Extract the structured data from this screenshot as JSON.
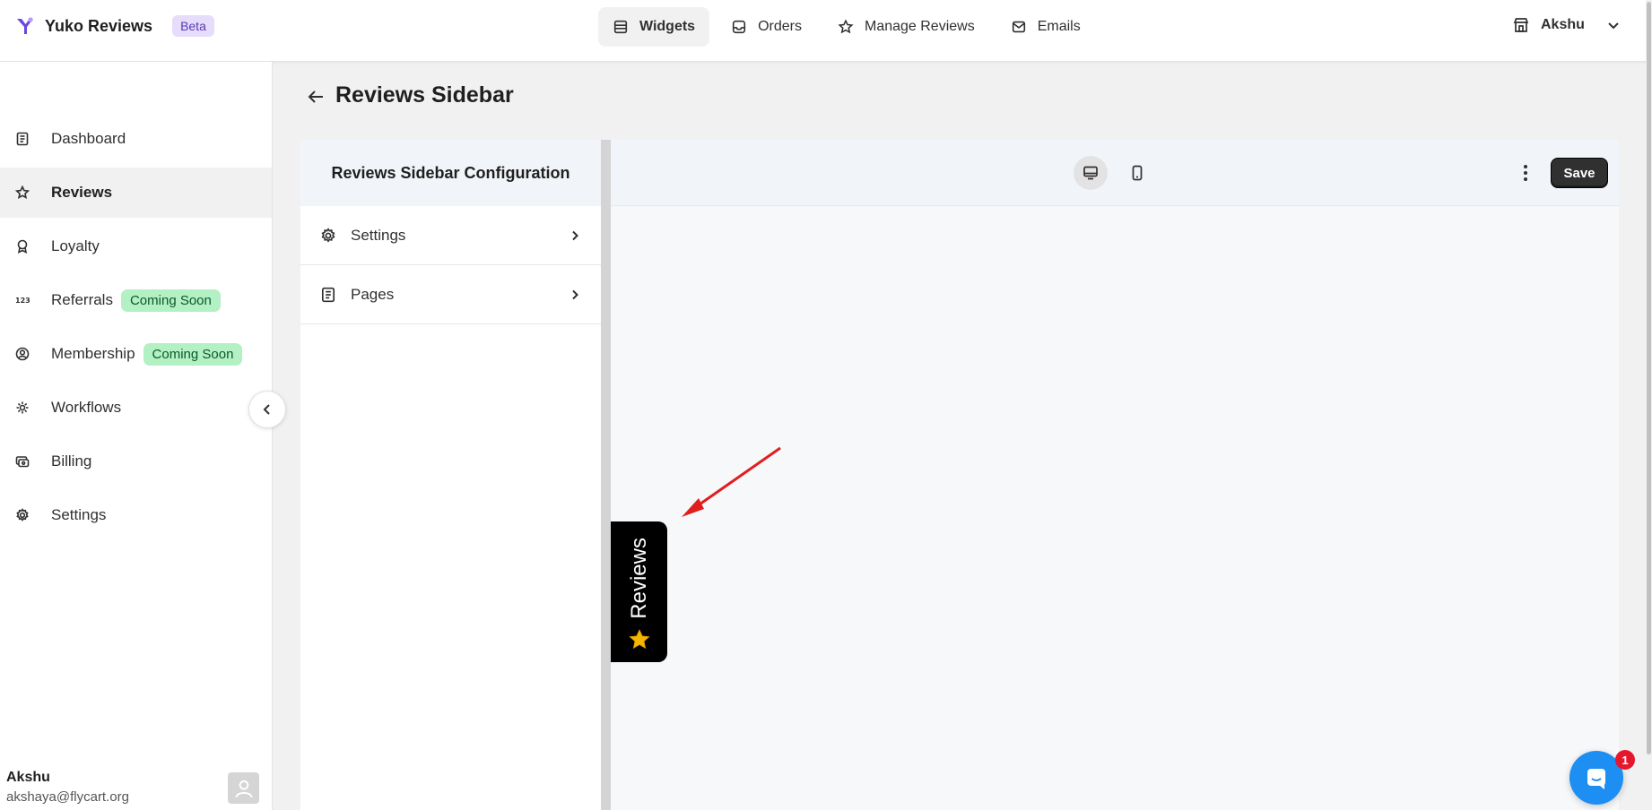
{
  "header": {
    "app_name": "Yuko Reviews",
    "beta_label": "Beta",
    "nav": [
      {
        "label": "Widgets",
        "icon": "widgets-icon",
        "active": true
      },
      {
        "label": "Orders",
        "icon": "inbox-icon"
      },
      {
        "label": "Manage Reviews",
        "icon": "star-icon"
      },
      {
        "label": "Emails",
        "icon": "mail-icon"
      }
    ],
    "user_label": "Akshu"
  },
  "sidebar": {
    "items": [
      {
        "label": "Dashboard",
        "icon": "dashboard-icon"
      },
      {
        "label": "Reviews",
        "icon": "star-icon",
        "active": true
      },
      {
        "label": "Loyalty",
        "icon": "award-icon"
      },
      {
        "label": "Referrals",
        "icon": "referrals-icon",
        "badge": "Coming Soon"
      },
      {
        "label": "Membership",
        "icon": "membership-icon",
        "badge": "Coming Soon"
      },
      {
        "label": "Workflows",
        "icon": "workflow-icon"
      },
      {
        "label": "Billing",
        "icon": "billing-icon"
      },
      {
        "label": "Settings",
        "icon": "gear-icon"
      }
    ],
    "user": {
      "name": "Akshu",
      "email": "akshaya@flycart.org"
    }
  },
  "page": {
    "title": "Reviews Sidebar"
  },
  "config": {
    "title": "Reviews Sidebar Configuration",
    "rows": [
      {
        "label": "Settings",
        "icon": "gear-icon"
      },
      {
        "label": "Pages",
        "icon": "pages-icon"
      }
    ]
  },
  "preview": {
    "save_label": "Save",
    "view_mode": "desktop",
    "tab_label": "Reviews",
    "tab_color": "#000000",
    "star_color": "#f5b400"
  },
  "chat": {
    "badge_count": "1"
  },
  "colors": {
    "accent": "#303030",
    "coming_soon_bg": "#b3f0c4",
    "beta_bg": "#e6dcfb",
    "arrow": "#e01e1e"
  }
}
